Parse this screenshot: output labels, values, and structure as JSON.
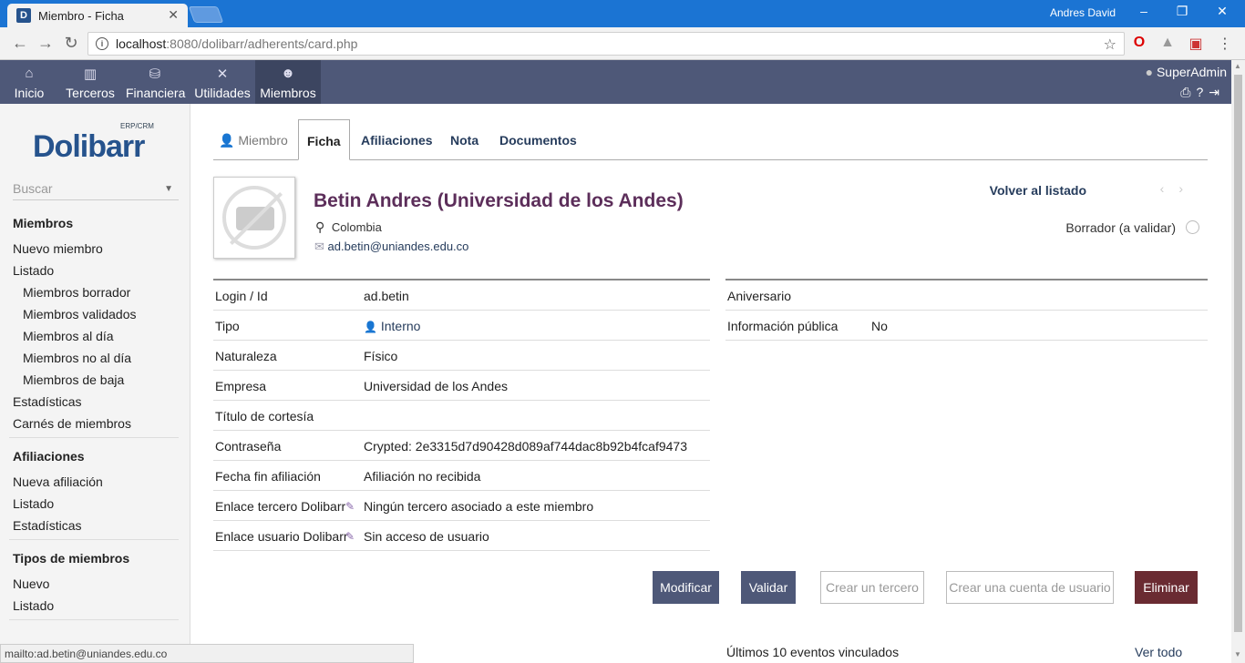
{
  "browser": {
    "tab_title": "Miembro - Ficha",
    "favicon_letter": "D",
    "user": "Andres David",
    "url_host": "localhost",
    "url_path": ":8080/dolibarr/adherents/card.php",
    "status_link": "mailto:ad.betin@uniandes.edu.co"
  },
  "topmenu": {
    "items": [
      {
        "label": "Inicio",
        "icon": "home-icon"
      },
      {
        "label": "Terceros",
        "icon": "building-icon"
      },
      {
        "label": "Financiera",
        "icon": "coins-icon"
      },
      {
        "label": "Utilidades",
        "icon": "tools-icon"
      },
      {
        "label": "Miembros",
        "icon": "members-icon"
      }
    ],
    "user": "SuperAdmin"
  },
  "sidebar": {
    "logo_word": "Dolibarr",
    "logo_tag": "ERP/CRM",
    "search_placeholder": "Buscar",
    "members": {
      "title": "Miembros",
      "new": "Nuevo miembro",
      "list": "Listado",
      "draft": "Miembros borrador",
      "validated": "Miembros validados",
      "uptodate": "Miembros al día",
      "notuptodate": "Miembros no al día",
      "resigned": "Miembros de baja",
      "stats": "Estadísticas",
      "cards": "Carnés de miembros"
    },
    "subscriptions": {
      "title": "Afiliaciones",
      "new": "Nueva afiliación",
      "list": "Listado",
      "stats": "Estadísticas"
    },
    "types": {
      "title": "Tipos de miembros",
      "new": "Nuevo",
      "list": "Listado"
    }
  },
  "tabs": {
    "member": "Miembro",
    "card": "Ficha",
    "subscriptions": "Afiliaciones",
    "note": "Nota",
    "documents": "Documentos"
  },
  "header": {
    "name": "Betin Andres (Universidad de los Andes)",
    "country": "Colombia",
    "email": "ad.betin@uniandes.edu.co",
    "back_to_list": "Volver al listado",
    "status": "Borrador (a validar)"
  },
  "fields_left": [
    {
      "key": "Login / Id",
      "value": "ad.betin"
    },
    {
      "key": "Tipo",
      "value": "Interno"
    },
    {
      "key": "Naturaleza",
      "value": "Físico"
    },
    {
      "key": "Empresa",
      "value": "Universidad de los Andes"
    },
    {
      "key": "Título de cortesía",
      "value": ""
    },
    {
      "key": "Contraseña",
      "value": "Crypted: 2e3315d7d90428d089af744dac8b92b4fcaf9473"
    },
    {
      "key": "Fecha fin afiliación",
      "value": "Afiliación no recibida"
    },
    {
      "key": "Enlace tercero Dolibarr",
      "value": "Ningún tercero asociado a este miembro"
    },
    {
      "key": "Enlace usuario Dolibarr",
      "value": "Sin acceso de usuario"
    }
  ],
  "fields_right": [
    {
      "key": "Aniversario",
      "value": ""
    },
    {
      "key": "Información pública",
      "value": "No"
    }
  ],
  "actions": {
    "modify": "Modificar",
    "validate": "Validar",
    "create_thirdparty": "Crear un tercero",
    "create_user": "Crear una cuenta de usuario",
    "delete": "Eliminar"
  },
  "events": {
    "title": "Últimos 10 eventos vinculados",
    "see_all": "Ver todo"
  }
}
